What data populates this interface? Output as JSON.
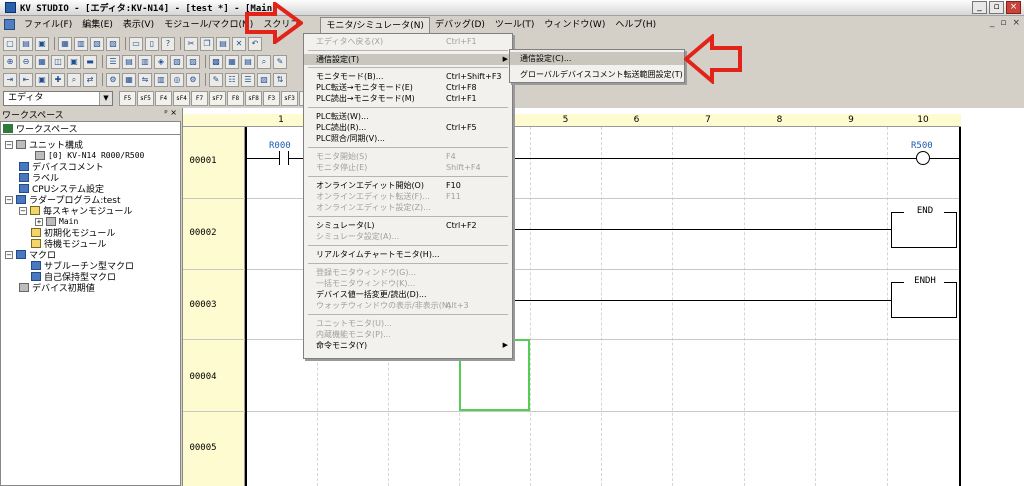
{
  "title_bar": {
    "title": "KV STUDIO - [エディタ:KV-N14] - [test *] - [Main]",
    "minimize": "_",
    "restore": "▫",
    "close": "×"
  },
  "menu_bar": {
    "items": [
      "ファイル(F)",
      "編集(E)",
      "表示(V)",
      "モジュール/マクロ(M)",
      "スクリプ",
      "モニタ/シミュレータ(N)",
      "デバッグ(D)",
      "ツール(T)",
      "ウィンドウ(W)",
      "ヘルプ(H)"
    ],
    "mdi_controls": [
      "_",
      "▫",
      "×"
    ]
  },
  "toolbar": {
    "mode_select": "エディタ",
    "fkeys": [
      "F5",
      "sF5",
      "F4",
      "sF4",
      "F7",
      "sF7",
      "F8",
      "sF8",
      "F3",
      "sF3",
      "AF"
    ]
  },
  "workspace": {
    "header": "ワークスペース",
    "pin": "ᵖ ×",
    "tab": "ワークスペース",
    "tree": [
      "ユニット構成",
      "[0]  KV-N14        R000/R500",
      "デバイスコメント",
      "ラベル",
      "CPUシステム設定",
      "ラダープログラム:test",
      "毎スキャンモジュール",
      "Main",
      "初期化モジュール",
      "待機モジュール",
      "マクロ",
      "サブルーチン型マクロ",
      "自己保持型マクロ",
      "デバイス初期値"
    ]
  },
  "ladder": {
    "columns": [
      "1",
      "5",
      "6",
      "7",
      "8",
      "9",
      "10"
    ],
    "rows": [
      "00001",
      "00002",
      "00003",
      "00004",
      "00005"
    ],
    "contact_label": "R000",
    "coil_label": "R500",
    "instr_end": "END",
    "instr_endh": "ENDH"
  },
  "monitor_menu": {
    "items": [
      {
        "label": "エディタへ戻る(X)",
        "shortcut": "Ctrl+F1",
        "disabled": true
      },
      {
        "label": "通信設定(T)",
        "shortcut": "",
        "highlight": true,
        "submenu": true
      },
      {
        "label": "モニタモード(B)...",
        "shortcut": "Ctrl+Shift+F3"
      },
      {
        "label": "PLC転送→モニタモード(E)",
        "shortcut": "Ctrl+F8"
      },
      {
        "label": "PLC読出→モニタモード(M)",
        "shortcut": "Ctrl+F1"
      },
      {
        "label": "PLC転送(W)...",
        "shortcut": ""
      },
      {
        "label": "PLC読出(R)...",
        "shortcut": "Ctrl+F5"
      },
      {
        "label": "PLC照合/同期(V)...",
        "shortcut": ""
      },
      {
        "label": "モニタ開始(S)",
        "shortcut": "F4",
        "disabled": true
      },
      {
        "label": "モニタ停止(E)",
        "shortcut": "Shift+F4",
        "disabled": true
      },
      {
        "label": "オンラインエディット開始(O)",
        "shortcut": "F10"
      },
      {
        "label": "オンラインエディット転送(F)...",
        "shortcut": "F11",
        "disabled": true
      },
      {
        "label": "オンラインエディット設定(Z)...",
        "shortcut": "",
        "disabled": true
      },
      {
        "label": "シミュレータ(L)",
        "shortcut": "Ctrl+F2"
      },
      {
        "label": "シミュレータ設定(A)...",
        "shortcut": "",
        "disabled": true
      },
      {
        "label": "リアルタイムチャートモニタ(H)...",
        "shortcut": ""
      },
      {
        "label": "登録モニタウィンドウ(G)...",
        "shortcut": "",
        "disabled": true
      },
      {
        "label": "一括モニタウィンドウ(K)...",
        "shortcut": "",
        "disabled": true
      },
      {
        "label": "デバイス値一括変更/読出(D)...",
        "shortcut": ""
      },
      {
        "label": "ウォッチウィンドウの表示/非表示(N)",
        "shortcut": "Alt+3",
        "disabled": true
      },
      {
        "label": "ユニットモニタ(U)...",
        "shortcut": "",
        "disabled": true
      },
      {
        "label": "内蔵機能モニタ(P)...",
        "shortcut": "",
        "disabled": true
      },
      {
        "label": "命令モニタ(Y)",
        "shortcut": "",
        "submenu": true
      }
    ]
  },
  "comm_submenu": {
    "items": [
      "通信設定(C)...",
      "グローバルデバイスコメント転送範囲設定(T)"
    ]
  },
  "colors": {
    "arrow_red": "#e2231a",
    "cursor_green": "#55cc55",
    "device_label_blue": "#1e5ab4"
  }
}
